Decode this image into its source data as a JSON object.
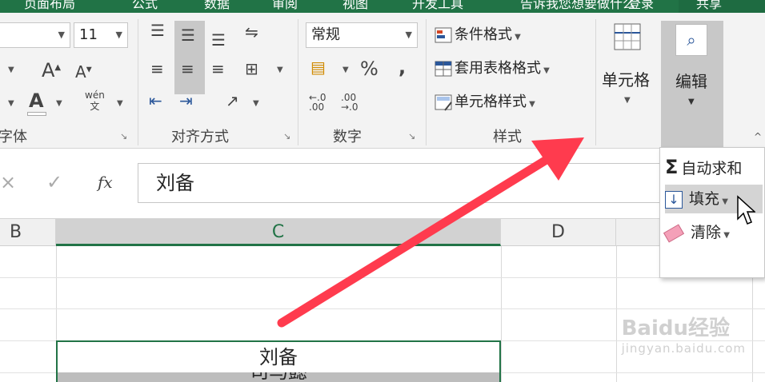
{
  "tabs": [
    {
      "label": "页面布局"
    },
    {
      "label": "公式"
    },
    {
      "label": "数据"
    },
    {
      "label": "审阅"
    },
    {
      "label": "视图"
    },
    {
      "label": "开发工具"
    },
    {
      "label": "告诉我您想要做什么"
    },
    {
      "label": "登录"
    },
    {
      "label": "共享"
    }
  ],
  "ribbon": {
    "font_group": {
      "label": "字体",
      "font_size": "11",
      "phonetic_label": "wén\n文"
    },
    "alignment_group": {
      "label": "对齐方式"
    },
    "number_group": {
      "label": "数字",
      "format_value": "常规",
      "percent_symbol": "%",
      "comma_symbol": ",",
      "increase_decimal": "←.0 .00",
      "decrease_decimal": ".00 →.0"
    },
    "styles_group": {
      "label": "样式",
      "conditional_formatting": "条件格式",
      "format_as_table": "套用表格格式",
      "cell_styles": "单元格样式"
    },
    "cells_group": {
      "button_label": "单元格"
    },
    "editing_group": {
      "button_label": "编辑"
    }
  },
  "formula_bar": {
    "cancel": "×",
    "enter": "✓",
    "fx": "fx",
    "value": "刘备"
  },
  "columns": [
    {
      "label": "B"
    },
    {
      "label": "C"
    },
    {
      "label": "D"
    }
  ],
  "cell_c": {
    "value": "刘备"
  },
  "cell_c_next": {
    "value": "司马懿"
  },
  "edit_dropdown": {
    "items": [
      {
        "label": "自动求和"
      },
      {
        "label": "填充"
      },
      {
        "label": "清除"
      }
    ]
  },
  "watermark": {
    "text": "Baidu经验",
    "sub": "jingyan.baidu.com"
  },
  "colors": {
    "excel_green": "#217346",
    "arrow_red": "#ff3b4e",
    "ribbon_bg": "#f3f3f3",
    "highlight": "#c8c8c8"
  }
}
